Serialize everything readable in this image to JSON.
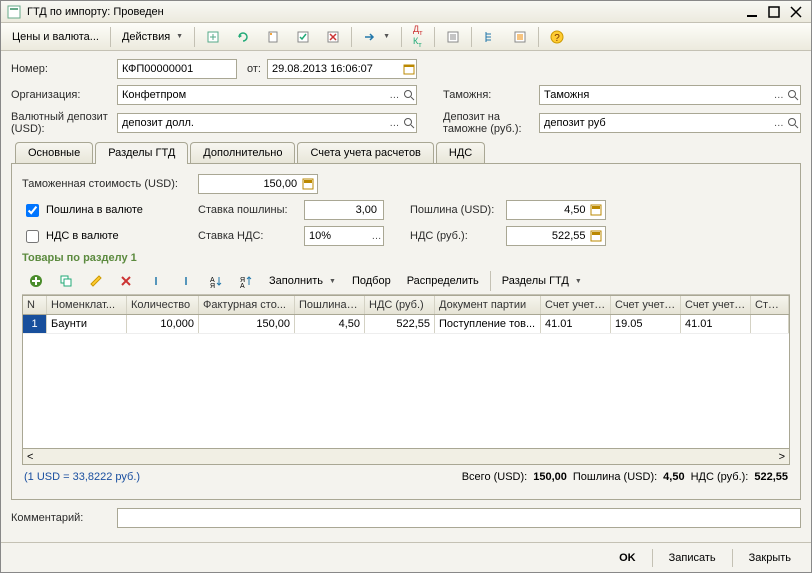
{
  "window": {
    "title": "ГТД по импорту: Проведен"
  },
  "toolbar": {
    "currencies": "Цены и валюта...",
    "actions": "Действия"
  },
  "form": {
    "number_label": "Номер:",
    "number": "КФП00000001",
    "from_label": "от:",
    "date": "29.08.2013 16:06:07",
    "org_label": "Организация:",
    "org": "Конфетпром",
    "customs_label": "Таможня:",
    "customs": "Таможня",
    "depo_usd_label": "Валютный депозит (USD):",
    "depo_usd": "депозит долл.",
    "depo_rub_label": "Депозит на таможне (руб.):",
    "depo_rub": "депозит руб"
  },
  "tabs": {
    "t1": "Основные",
    "t2": "Разделы ГТД",
    "t3": "Дополнительно",
    "t4": "Счета учета расчетов",
    "t5": "НДС"
  },
  "tabbody": {
    "customs_value_label": "Таможенная стоимость (USD):",
    "customs_value": "150,00",
    "duty_in_currency": "Пошлина в валюте",
    "duty_rate_label": "Ставка пошлины:",
    "duty_rate": "3,00",
    "duty_usd_label": "Пошлина (USD):",
    "duty_usd": "4,50",
    "vat_in_currency": "НДС в валюте",
    "vat_rate_label": "Ставка НДС:",
    "vat_rate": "10%",
    "vat_rub_label": "НДС (руб.):",
    "vat_rub": "522,55"
  },
  "goods": {
    "section_title": "Товары по разделу 1",
    "fill": "Заполнить",
    "pick": "Подбор",
    "distribute": "Распределить",
    "gtd_sections": "Разделы ГТД",
    "cols": {
      "n": "N",
      "nomen": "Номенклат...",
      "qty": "Количество",
      "invoice": "Фактурная сто...",
      "duty": "Пошлина (...",
      "vat": "НДС (руб.)",
      "doc": "Документ партии",
      "acc1": "Счет учета...",
      "acc2": "Счет учета...",
      "acc3": "Счет учета...",
      "article": "Статья"
    },
    "rows": [
      {
        "n": "1",
        "nomen": "Баунти",
        "qty": "10,000",
        "invoice": "150,00",
        "duty": "4,50",
        "vat": "522,55",
        "doc": "Поступление тов...",
        "acc1": "41.01",
        "acc2": "19.05",
        "acc3": "41.01",
        "article": ""
      }
    ]
  },
  "totals": {
    "rate": "(1 USD = 33,8222 руб.)",
    "total_label": "Всего (USD):",
    "total": "150,00",
    "duty_label": "Пошлина (USD):",
    "duty": "4,50",
    "vat_label": "НДС (руб.):",
    "vat": "522,55"
  },
  "comment_label": "Комментарий:",
  "comment": "",
  "footer": {
    "ok": "OK",
    "save": "Записать",
    "close": "Закрыть"
  }
}
